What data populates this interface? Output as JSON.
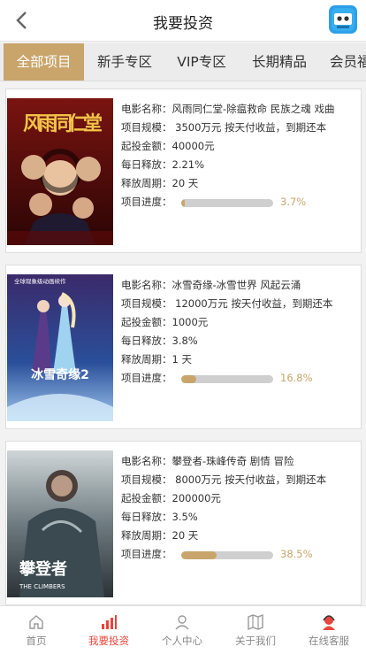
{
  "header": {
    "title": "我要投资"
  },
  "tabs": [
    {
      "label": "全部项目",
      "active": true
    },
    {
      "label": "新手专区",
      "active": false
    },
    {
      "label": "VIP专区",
      "active": false
    },
    {
      "label": "长期精品",
      "active": false
    },
    {
      "label": "会员福",
      "active": false
    }
  ],
  "projects": [
    {
      "poster": {
        "title_text": "风雨同仁堂",
        "tagline": ""
      },
      "name": "电影名称：风雨同仁堂-除瘟救命 民族之魂 戏曲",
      "scale": "项目规模： 3500万元 按天付收益，到期还本",
      "min_amount": "起投金额：40000元",
      "daily": "每日释放：2.21%",
      "cycle": "释放周期：20 天",
      "progress_label": "项目进度：",
      "progress_value": 3.7,
      "progress_text": "3.7%"
    },
    {
      "poster": {
        "title_text": "冰雪奇缘2",
        "tagline": "全球现象级动画续作"
      },
      "name": "电影名称：冰雪奇缘-冰雪世界 风起云涌",
      "scale": "项目规模： 12000万元 按天付收益，到期还本",
      "min_amount": "起投金额：1000元",
      "daily": "每日释放：3.8%",
      "cycle": "释放周期：1 天",
      "progress_label": "项目进度：",
      "progress_value": 16.8,
      "progress_text": "16.8%"
    },
    {
      "poster": {
        "title_text": "攀登者",
        "tagline": "THE CLIMBERS"
      },
      "name": "电影名称：攀登者-珠峰传奇 剧情 冒险",
      "scale": "项目规模： 8000万元 按天付收益，到期还本",
      "min_amount": "起投金额：200000元",
      "daily": "每日释放：3.5%",
      "cycle": "释放周期：20 天",
      "progress_label": "项目进度：",
      "progress_value": 38.5,
      "progress_text": "38.5%"
    }
  ],
  "tabbar": [
    {
      "label": "首页",
      "icon": "home-icon",
      "active": false
    },
    {
      "label": "我要投资",
      "icon": "chart-icon",
      "active": true
    },
    {
      "label": "个人中心",
      "icon": "user-icon",
      "active": false
    },
    {
      "label": "关于我们",
      "icon": "map-icon",
      "active": false
    },
    {
      "label": "在线客服",
      "icon": "support-agent-icon",
      "active": false
    }
  ],
  "colors": {
    "accent": "#c9a56b",
    "active_tab_text": "#e8463a",
    "icon_blue": "#2d9fe8"
  }
}
